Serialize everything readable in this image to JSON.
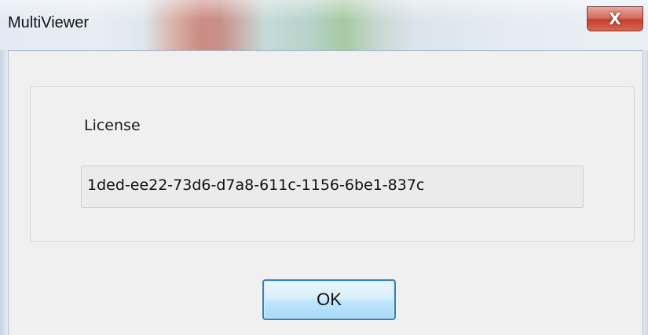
{
  "window": {
    "title": "MultiViewer",
    "close_icon": "close-icon",
    "close_glyph": "X"
  },
  "license": {
    "label": "License",
    "value": "1ded-ee22-73d6-d7a8-611c-1156-6be1-837c"
  },
  "buttons": {
    "ok_label": "OK"
  },
  "colors": {
    "dialog_background": "#f0f0f0",
    "close_button": "#c4402b",
    "ok_button_border": "#3c7fb1",
    "field_background": "#ebebeb"
  }
}
